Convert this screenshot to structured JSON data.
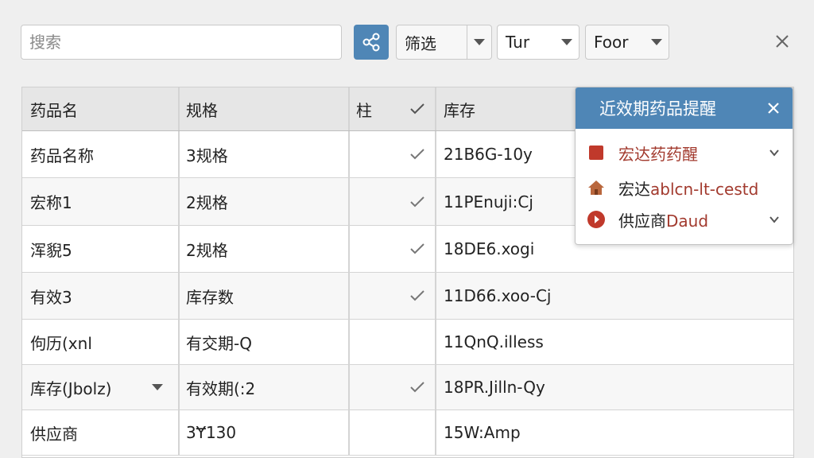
{
  "toolbar": {
    "search_placeholder": "搜索",
    "filter_label": "筛选",
    "dropdown2_label": "Tur",
    "dropdown3_label": "Foor",
    "share_icon": "share-icon",
    "close_icon": "close-icon"
  },
  "table": {
    "headers": [
      "药品名",
      "规格",
      "柱",
      "库存"
    ],
    "rows": [
      {
        "name": "药品名称",
        "spec": "3规格",
        "checked": true,
        "stock": "21B6G-10y"
      },
      {
        "name": "宏称1",
        "spec": "2规格",
        "checked": true,
        "stock": "11PEnuji:Cj"
      },
      {
        "name": "浑貎5",
        "spec": "2规格",
        "checked": true,
        "stock": "18DE6.xogi"
      },
      {
        "name": "有效3",
        "spec": "库存数",
        "checked": true,
        "stock": "11D66.xoo-Cj"
      },
      {
        "name": "佝历(xnl",
        "spec": "有交期-Q",
        "checked": false,
        "stock": "11QnQ.illess"
      },
      {
        "name": "库存(Jbolz)",
        "spec": "有效期(:2",
        "checked": true,
        "stock": "18PR.Jilln-Qy"
      },
      {
        "name": "供应商",
        "spec": "3Ɏ130",
        "checked": false,
        "stock": "15W:Amp"
      }
    ]
  },
  "popup": {
    "title": "近效期药品提醒",
    "items": [
      {
        "text": "宏达药药醒",
        "icon": "square-icon"
      },
      {
        "text_a": "宏达",
        "text_b": "ablcn-lt-cestd",
        "icon": "house-icon"
      },
      {
        "text_a": "供应商",
        "text_b": "Daud",
        "icon": "play-circle-icon"
      }
    ]
  },
  "colors": {
    "accent": "#4f86b6",
    "popup_red": "#a23a2e",
    "background": "#efefef"
  }
}
